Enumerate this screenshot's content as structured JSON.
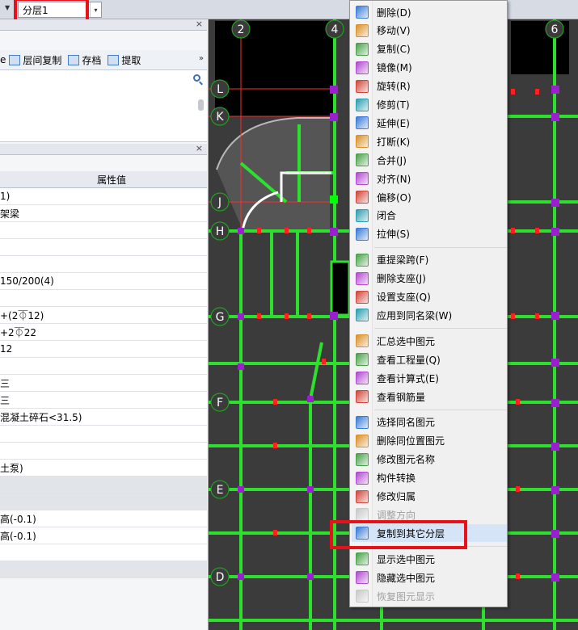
{
  "toolbar": {
    "layer_value": "分层1",
    "dropdown_arrow": "▾"
  },
  "left_panel": {
    "toolbar_items": [
      {
        "label": "层间复制",
        "icon": "copy-floors-icon"
      },
      {
        "label": "存档",
        "icon": "save-archive-icon"
      },
      {
        "label": "提取",
        "icon": "extract-icon"
      }
    ],
    "partial_leading_label": "e",
    "more_symbol": "»",
    "close_symbol": "×",
    "properties": {
      "header": "属性值",
      "rows": [
        "1)",
        "架梁",
        "",
        "",
        "",
        "150/200(4)",
        "",
        "+(2⏁12)",
        "+2⏁22",
        "12",
        "",
        "三",
        "三",
        "混凝土碎石<31.5)",
        "",
        "",
        "土泵)",
        "",
        "",
        "高(-0.1)",
        "高(-0.1)",
        "",
        ""
      ],
      "group_rows": [
        17,
        18,
        22
      ]
    }
  },
  "canvas": {
    "axis_labels": [
      {
        "label": "2"
      },
      {
        "label": "4"
      },
      {
        "label": "6"
      },
      {
        "label": "L"
      },
      {
        "label": "K"
      },
      {
        "label": "J"
      },
      {
        "label": "H"
      },
      {
        "label": "G"
      },
      {
        "label": "F"
      },
      {
        "label": "E"
      },
      {
        "label": "D"
      }
    ]
  },
  "context_menu": {
    "items": [
      {
        "label": "删除(D)",
        "icon": "brush-icon",
        "enabled": true
      },
      {
        "label": "移动(V)",
        "icon": "move-arrows-icon",
        "enabled": true
      },
      {
        "label": "复制(C)",
        "icon": "copy-icon",
        "enabled": true
      },
      {
        "label": "镜像(M)",
        "icon": "mirror-icon",
        "enabled": true
      },
      {
        "label": "旋转(R)",
        "icon": "rotate-icon",
        "enabled": true
      },
      {
        "label": "修剪(T)",
        "icon": "trim-icon",
        "enabled": true
      },
      {
        "label": "延伸(E)",
        "icon": "extend-icon",
        "enabled": true
      },
      {
        "label": "打断(K)",
        "icon": "break-icon",
        "enabled": true
      },
      {
        "label": "合并(J)",
        "icon": "merge-icon",
        "enabled": true
      },
      {
        "label": "对齐(N)",
        "icon": "align-icon",
        "enabled": true
      },
      {
        "label": "偏移(O)",
        "icon": "offset-icon",
        "enabled": true
      },
      {
        "label": "闭合",
        "icon": "close-shape-icon",
        "enabled": true
      },
      {
        "label": "拉伸(S)",
        "icon": "stretch-icon",
        "enabled": true
      },
      {
        "separator": true
      },
      {
        "label": "重提梁跨(F)",
        "icon": "beam-span-icon",
        "enabled": true
      },
      {
        "label": "删除支座(J)",
        "icon": "delete-support-icon",
        "enabled": true
      },
      {
        "label": "设置支座(Q)",
        "icon": "set-support-icon",
        "enabled": true
      },
      {
        "label": "应用到同名梁(W)",
        "icon": "apply-same-beam-icon",
        "enabled": true
      },
      {
        "separator": true
      },
      {
        "label": "汇总选中图元",
        "icon": "sigma-icon",
        "enabled": true
      },
      {
        "label": "查看工程量(Q)",
        "icon": "quantity-icon",
        "enabled": true
      },
      {
        "label": "查看计算式(E)",
        "icon": "formula-icon",
        "enabled": true
      },
      {
        "label": "查看钢筋量",
        "icon": "rebar-icon",
        "enabled": true
      },
      {
        "separator": true
      },
      {
        "label": "选择同名图元",
        "icon": "select-same-icon",
        "enabled": true
      },
      {
        "label": "删除同位置图元",
        "icon": "delete-same-position-icon",
        "enabled": true
      },
      {
        "label": "修改图元名称",
        "icon": "rename-icon",
        "enabled": true
      },
      {
        "label": "构件转换",
        "icon": "convert-icon",
        "enabled": true
      },
      {
        "label": "修改归属",
        "icon": "ownership-icon",
        "enabled": true
      },
      {
        "label": "调整方向",
        "icon": "direction-icon",
        "enabled": false
      },
      {
        "label": "复制到其它分层",
        "icon": "copy-to-layer-icon",
        "enabled": true,
        "selected": true
      },
      {
        "separator": true
      },
      {
        "label": "显示选中图元",
        "icon": "show-icon",
        "enabled": true
      },
      {
        "label": "隐藏选中图元",
        "icon": "hide-icon",
        "enabled": true
      },
      {
        "label": "恢复图元显示",
        "icon": "restore-icon",
        "enabled": false
      }
    ]
  },
  "colors": {
    "highlight_red": "#e8111a",
    "beam_green": "#2ee02e",
    "column_purple": "#9b1fd0",
    "grid_red": "#ff2a2a",
    "menu_selected": "#d6e4f7"
  }
}
